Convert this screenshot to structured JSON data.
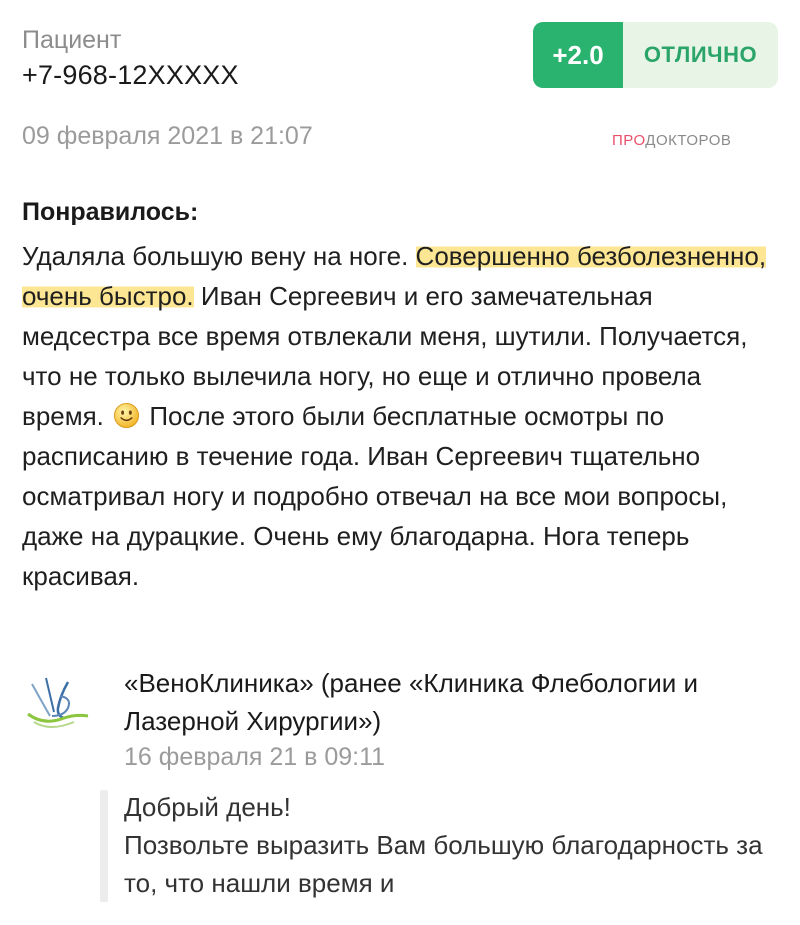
{
  "patient": {
    "label": "Пациент",
    "phone": "+7-968-12XXXXX"
  },
  "rating": {
    "score": "+2.0",
    "label": "ОТЛИЧНО",
    "score_color": "#29b36f",
    "label_bg": "#e8f5e6"
  },
  "review": {
    "date": "09 февраля 2021 в 21:07",
    "source_part1": "ПРО",
    "source_part2": "ДОКТОРОВ",
    "heading": "Понравилось:",
    "text_1": "Удаляла большую вену на ноге. ",
    "text_highlight": "Совершенно безболезненно, очень быстро.",
    "text_2": " Иван Сергеевич и его замечательная медсестра все время отвлекали меня, шутили. Получается, что не только вылечила ногу, но еще и отлично провела время. ",
    "text_3": " После этого были бесплатные осмотры по расписанию в течение года. Иван Сергеевич тщательно осматривал ногу и подробно отвечал на все мои вопросы, даже на дурацкие. Очень ему благодарна. Нога теперь красивая.",
    "emoji": "smiley-icon",
    "highlight_color": "#fde280"
  },
  "reply": {
    "clinic_name": "«ВеноКлиника» (ранее «Клиника Флебологии и Лазерной Хирургии»)",
    "date": "16 февраля 21 в 09:11",
    "line_1": "Добрый день!",
    "line_2": "Позвольте выразить Вам большую благодарность за то, что нашли время и"
  }
}
